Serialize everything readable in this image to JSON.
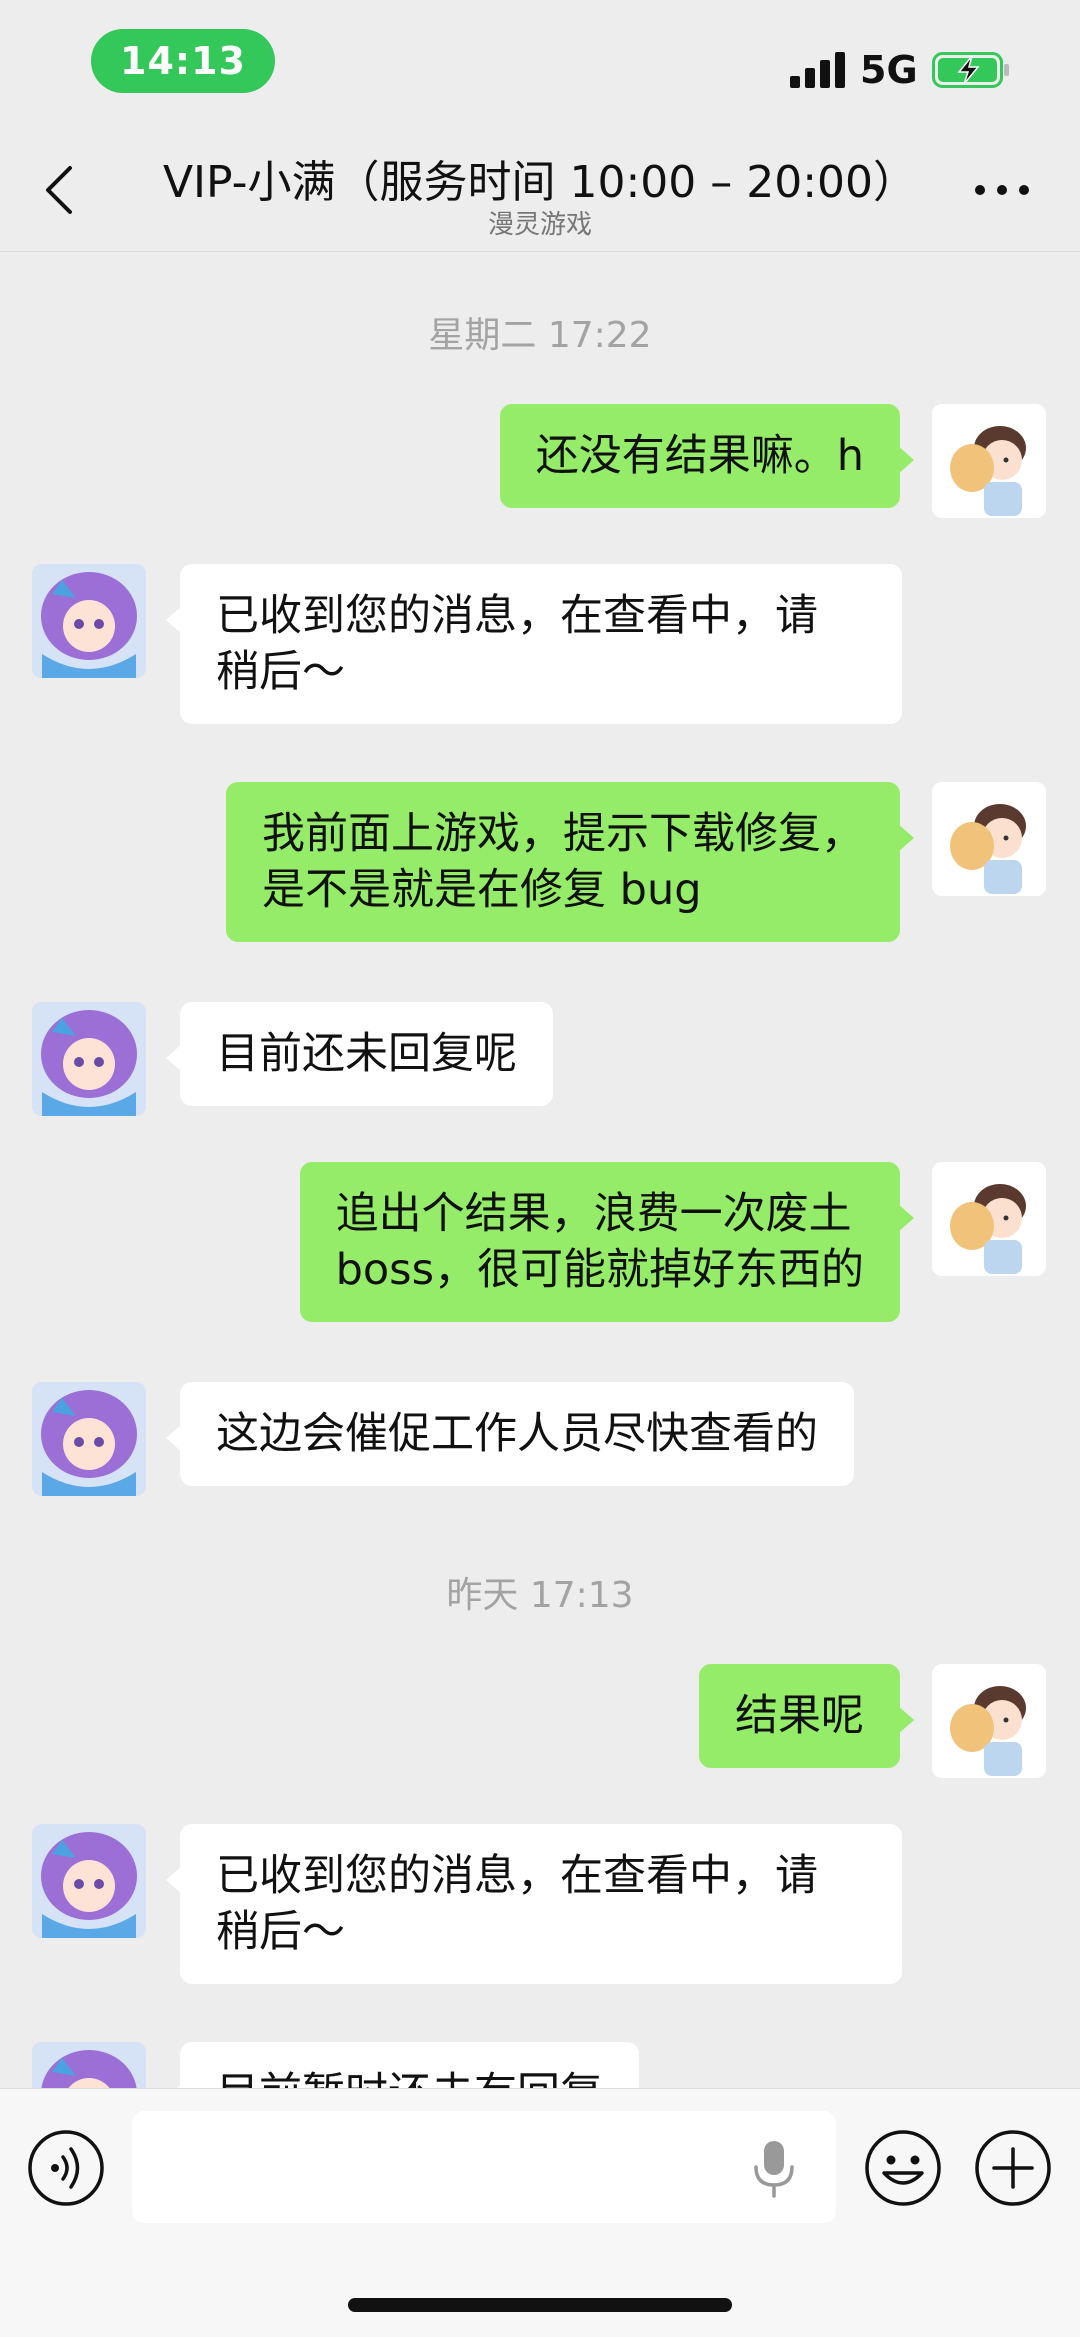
{
  "status_bar": {
    "time": "14:13",
    "network": "5G",
    "time_pill_color": "#34c759"
  },
  "header": {
    "title": "VIP-小满（服务时间 10:00 – 20:00）",
    "subtitle": "漫灵游戏"
  },
  "messages": [
    {
      "kind": "timestamp",
      "text": "星期二 17:22"
    },
    {
      "kind": "out",
      "lines": [
        "还没有结果嘛。h"
      ]
    },
    {
      "kind": "in",
      "lines": [
        "已收到您的消息，在查看中，请",
        "稍后～"
      ]
    },
    {
      "kind": "out",
      "lines": [
        "我前面上游戏，提示下载修复，",
        "是不是就是在修复 bug"
      ]
    },
    {
      "kind": "in",
      "lines": [
        "目前还未回复呢"
      ]
    },
    {
      "kind": "out",
      "lines": [
        "追出个结果，浪费一次废土",
        "boss，很可能就掉好东西的"
      ]
    },
    {
      "kind": "in",
      "lines": [
        "这边会催促工作人员尽快查看的"
      ]
    },
    {
      "kind": "timestamp",
      "text": "昨天 17:13"
    },
    {
      "kind": "out",
      "lines": [
        "结果呢"
      ]
    },
    {
      "kind": "in",
      "lines": [
        "已收到您的消息，在查看中，请",
        "稍后～"
      ]
    },
    {
      "kind": "in",
      "lines": [
        "目前暂时还未有回复"
      ]
    }
  ],
  "input": {
    "value": ""
  },
  "colors": {
    "background": "#ededed",
    "outgoing_bubble": "#95ec69",
    "incoming_bubble": "#ffffff",
    "timestamp_text": "#a3a3a3"
  },
  "icons": {
    "back": "chevron-left-icon",
    "more": "ellipsis-icon",
    "voice": "voice-icon",
    "mic": "microphone-icon",
    "emoji": "smiley-icon",
    "plus": "plus-icon"
  }
}
